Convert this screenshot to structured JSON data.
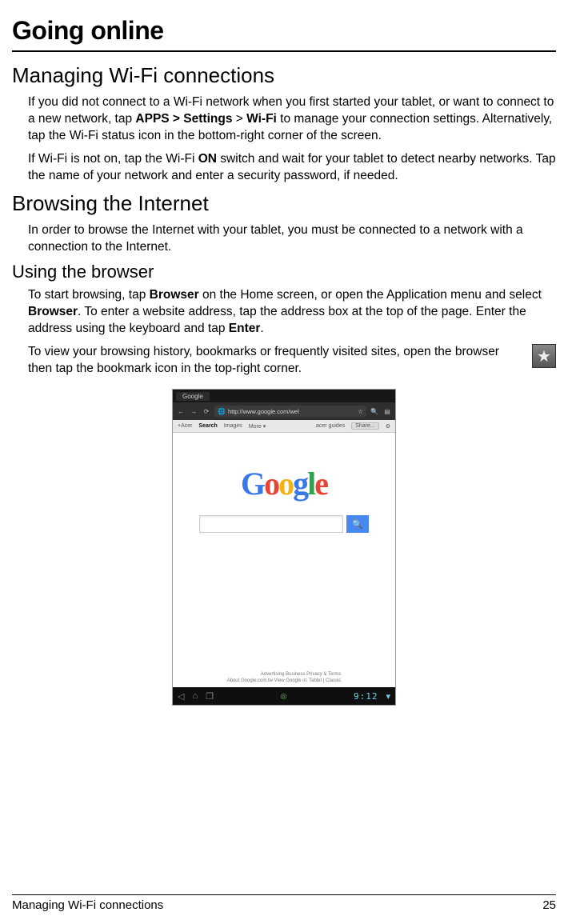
{
  "title": "Going online",
  "sections": {
    "wifi": {
      "heading": "Managing Wi-Fi connections",
      "p1_a": "If you did not connect to a Wi-Fi network when you first started your tablet, or want to connect to a new network, tap ",
      "p1_b": "APPS > Settings",
      "p1_c": " > ",
      "p1_d": "Wi-Fi",
      "p1_e": " to manage your connection settings. Alternatively, tap the Wi-Fi status icon in the bottom-right corner of the screen.",
      "p2_a": "If Wi-Fi is not on, tap the Wi-Fi ",
      "p2_b": "ON",
      "p2_c": " switch and wait for your tablet to detect nearby networks. Tap the name of your network and enter a security password, if needed."
    },
    "browsing": {
      "heading": "Browsing the Internet",
      "p1": "In order to browse the Internet with your tablet, you must be connected to a network with a connection to the Internet."
    },
    "using_browser": {
      "heading": "Using the browser",
      "p1_a": "To start browsing, tap ",
      "p1_b": "Browser",
      "p1_c": " on the Home screen, or open the Application menu and select ",
      "p1_d": "Browser",
      "p1_e": ". To enter a website address, tap the address box at the top of the page. Enter the address using the keyboard and tap ",
      "p1_f": "Enter",
      "p1_g": ".",
      "p2": "To view your browsing history, bookmarks or frequently visited sites, open the browser then tap the bookmark icon in the top-right corner."
    }
  },
  "screenshot": {
    "tab_title": "Google",
    "url": "http://www.google.com/wel",
    "subnav": {
      "item1": "+Acer",
      "item2": "Search",
      "item3": "Images",
      "item4": "More ▾",
      "user": "acer guides",
      "share": "Share..."
    },
    "logo": {
      "c1": "G",
      "c2": "o",
      "c3": "o",
      "c4": "g",
      "c5": "l",
      "c6": "e"
    },
    "footer_links": {
      "line1": "Advertising      Business      Privacy & Terms",
      "line2": "About      Google.com.tw        View Google in: Tablet | Classic"
    },
    "clock": "9:12"
  },
  "footer": {
    "left": "Managing Wi-Fi connections",
    "right": "25"
  }
}
